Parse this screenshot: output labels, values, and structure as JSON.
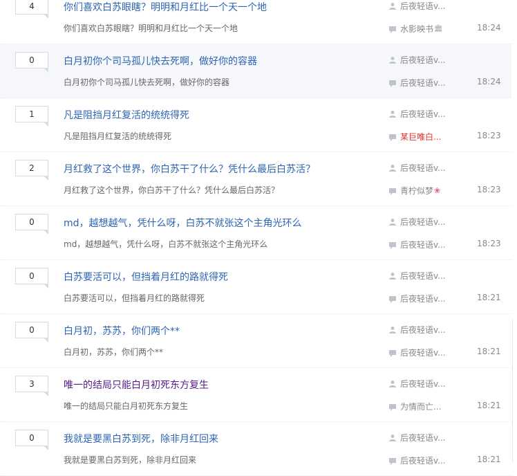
{
  "threads": [
    {
      "reply_count": "4",
      "title": "你们喜欢白苏眼瞎？明明和月红比一个天一个地",
      "abstract": "你们喜欢白苏眼瞎？明明和月红比一个天一个地",
      "author": "后夜轻语v...",
      "last_replier": "水影映书",
      "last_replier_badge": "🏛",
      "time": "18:24"
    },
    {
      "reply_count": "0",
      "title": "白月初你个司马孤儿快去死啊，做好你的容器",
      "abstract": "白月初你个司马孤儿快去死啊，做好你的容器",
      "author": "后夜轻语v...",
      "last_replier": "后夜轻语v...",
      "time": "18:24"
    },
    {
      "reply_count": "1",
      "title": "凡是阻挡月红复活的统统得死",
      "abstract": "凡是阻挡月红复活的统统得死",
      "author": "后夜轻语v...",
      "last_replier": "某巨唯白...",
      "last_replier_color": "#e4332e",
      "time": "18:23"
    },
    {
      "reply_count": "2",
      "title": "月红救了这个世界，你白苏干了什么？凭什么最后白苏活？",
      "abstract": "月红救了这个世界，你白苏干了什么？凭什么最后白苏活？",
      "author": "后夜轻语v...",
      "last_replier": "青柠似梦",
      "last_replier_flower": "❀",
      "time": "18:23"
    },
    {
      "reply_count": "0",
      "title": "md，越想越气，凭什么呀，白苏不就张这个主角光环么",
      "abstract": "md，越想越气，凭什么呀，白苏不就张这个主角光环么",
      "author": "后夜轻语v...",
      "last_replier": "后夜轻语v...",
      "time": "18:23"
    },
    {
      "reply_count": "0",
      "title": "白苏要活可以，但挡着月红的路就得死",
      "abstract": "白苏要活可以，但挡着月红的路就得死",
      "author": "后夜轻语v...",
      "last_replier": "后夜轻语v...",
      "time": "18:21"
    },
    {
      "reply_count": "0",
      "title": "白月初，苏苏，你们两个**",
      "abstract": "白月初，苏苏，你们两个**",
      "author": "后夜轻语v...",
      "last_replier": "后夜轻语v...",
      "time": "18:21"
    },
    {
      "reply_count": "3",
      "title": "唯一的结局只能白月初死东方复生",
      "abstract": "唯一的结局只能白月初死东方复生",
      "author": "后夜轻语v...",
      "last_replier": "为情而亡...",
      "time": "18:21"
    },
    {
      "reply_count": "0",
      "title": "我就是要黑白苏到死，除非月红回来",
      "abstract": "我就是要黑白苏到死，除非月红回来",
      "author": "后夜轻语v...",
      "last_replier": "后夜轻语v...",
      "time": "18:21"
    }
  ],
  "icons": {
    "author": "person-icon",
    "last_replier": "comment-icon"
  },
  "colors": {
    "title": "#2d64b3",
    "visited_title": "#551a8b",
    "red_name": "#e4332e"
  }
}
